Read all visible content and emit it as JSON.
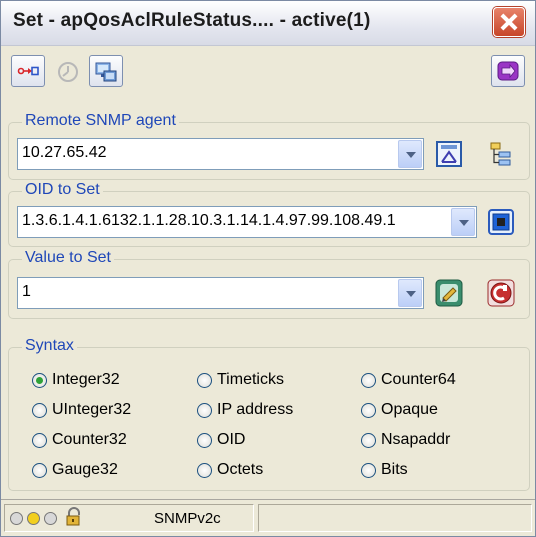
{
  "window": {
    "title": "Set - apQosAclRuleStatus.... - active(1)"
  },
  "remote_agent": {
    "legend": "Remote SNMP agent",
    "value": "10.27.65.42"
  },
  "oid": {
    "legend": "OID to Set",
    "value": "1.3.6.1.4.1.6132.1.1.28.10.3.1.14.1.4.97.99.108.49.1"
  },
  "value_to_set": {
    "legend": "Value to Set",
    "value": "1"
  },
  "syntax": {
    "legend": "Syntax",
    "options": [
      {
        "label": "Integer32",
        "selected": true
      },
      {
        "label": "Timeticks",
        "selected": false
      },
      {
        "label": "Counter64",
        "selected": false
      },
      {
        "label": "UInteger32",
        "selected": false
      },
      {
        "label": "IP address",
        "selected": false
      },
      {
        "label": "Opaque",
        "selected": false
      },
      {
        "label": "Counter32",
        "selected": false
      },
      {
        "label": "OID",
        "selected": false
      },
      {
        "label": "Nsapaddr",
        "selected": false
      },
      {
        "label": "Gauge32",
        "selected": false
      },
      {
        "label": "Octets",
        "selected": false
      },
      {
        "label": "Bits",
        "selected": false
      }
    ]
  },
  "statusbar": {
    "protocol": "SNMPv2c",
    "indicator_colors": [
      "#d8d8d8",
      "#f2cf1e",
      "#d8d8d8"
    ]
  },
  "icons": {
    "toolbar": [
      "connect-icon",
      "history-icon",
      "network-settings-icon",
      "exit-icon"
    ],
    "agent": [
      "agent-properties-icon",
      "agent-tree-icon"
    ],
    "oid": [
      "oid-select-icon"
    ],
    "value": [
      "value-edit-icon",
      "set-value-icon"
    ],
    "status": [
      "lock-icon"
    ]
  }
}
